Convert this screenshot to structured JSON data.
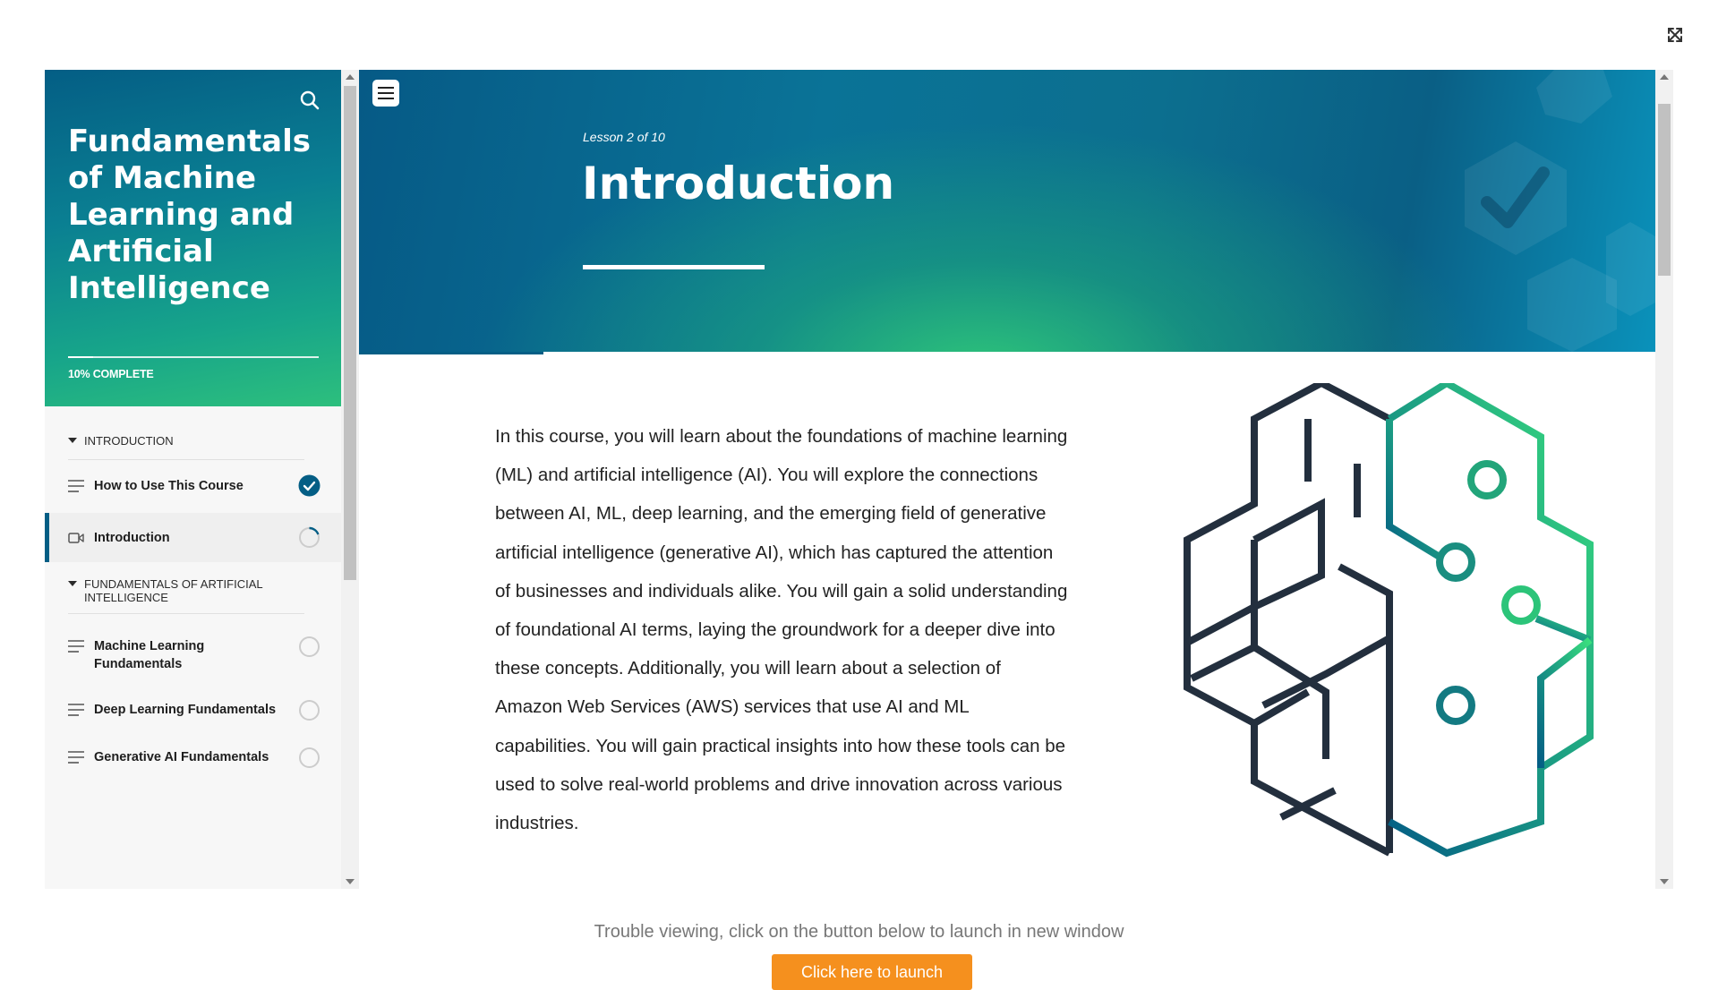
{
  "sidebar": {
    "course_title": "Fundamentals of Machine Learning and Artificial Intelligence",
    "progress_label": "10% COMPLETE",
    "progress_value": 0.1,
    "sections": [
      {
        "title": "INTRODUCTION",
        "lessons": [
          {
            "label": "How to Use This Course",
            "type": "text",
            "status": "complete"
          },
          {
            "label": "Introduction",
            "type": "video",
            "status": "in-progress",
            "active": true
          }
        ]
      },
      {
        "title": "FUNDAMENTALS OF ARTIFICIAL INTELLIGENCE",
        "lessons": [
          {
            "label": "Machine Learning Fundamentals",
            "type": "text",
            "status": "not-started"
          },
          {
            "label": "Deep Learning Fundamentals",
            "type": "text",
            "status": "not-started"
          },
          {
            "label": "Generative AI Fundamentals",
            "type": "text",
            "status": "not-started"
          }
        ]
      }
    ]
  },
  "banner": {
    "lesson_count": "Lesson 2 of 10",
    "title": "Introduction"
  },
  "content": {
    "paragraph": "In this course, you will learn about the foundations of machine learning (ML) and artificial intelligence (AI). You will explore the connections between AI, ML, deep learning, and the emerging field of generative artificial intelligence (generative AI), which has captured the attention of businesses and individuals alike. You will gain a solid understanding of foundational AI terms, laying the groundwork for a deeper dive into these concepts. Additionally, you will learn about a selection of Amazon Web Services (AWS) services that use AI and ML capabilities. You will gain practical insights into how these tools can be used to solve real-world problems and drive innovation across various industries."
  },
  "footer": {
    "trouble_text": "Trouble viewing, click on the button below to launch in new window",
    "launch_label": "Click here to launch"
  },
  "icons": {
    "expand": "expand-arrows-icon",
    "search": "search-icon",
    "menu": "hamburger-menu-icon",
    "complete": "checkmark-circle-icon",
    "in_progress": "progress-ring-icon",
    "not_started": "empty-circle-icon",
    "text_lesson": "text-lines-icon",
    "video_lesson": "video-camera-icon"
  },
  "colors": {
    "primary": "#045e85",
    "accent_green": "#2dbf7d",
    "launch_button": "#f5901e",
    "brain_dark": "#232f3e"
  }
}
